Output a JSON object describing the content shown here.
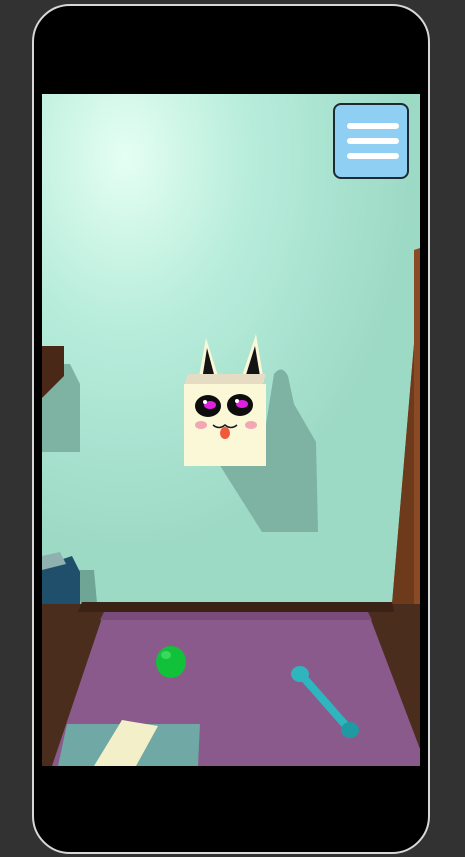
{
  "scene": {
    "colors": {
      "wall": "#a8e6d2",
      "wall_glow": "#dffbef",
      "shadow": "#6fa595",
      "rug": "#8b5a8c",
      "floor": "#4a2d1c",
      "shelf_right": "#8a4a25",
      "shelf_left": "#4a2818",
      "sofa": "#1f4f6a",
      "mat": "#6fa8a4",
      "paper": "#f3efc8",
      "ball": "#12c13a",
      "bone": "#2fb5bd",
      "pet_body": "#fbf8d8",
      "pet_eye": "#e020e0",
      "pet_cheek": "#f3a6b4",
      "pet_tongue": "#f05a38"
    },
    "objects": {
      "pet": "cube-bunny-pet",
      "ball": "green-ball-toy",
      "bone": "blue-bone-toy",
      "rug": "purple-rug",
      "mat": "teal-mat"
    }
  },
  "menu": {
    "icon": "hamburger-menu-icon",
    "background_color": "#8fcff3"
  }
}
